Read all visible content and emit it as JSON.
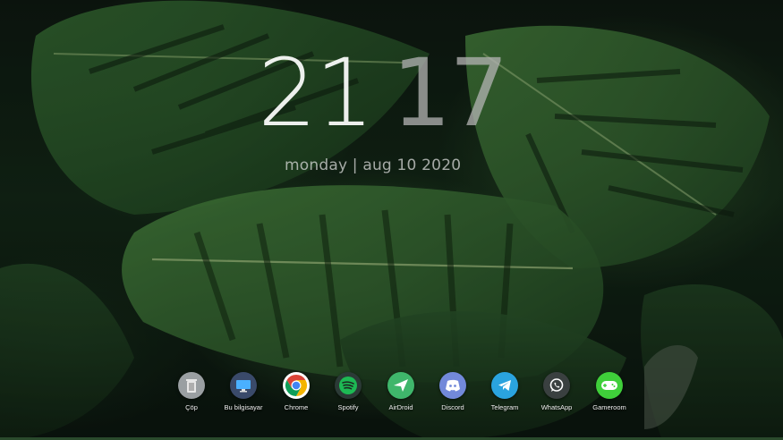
{
  "clock": {
    "hours": "21",
    "minutes": "17"
  },
  "date": "monday | aug 10 2020",
  "dock": {
    "items": [
      {
        "label": "Çöp",
        "icon": "trash-icon",
        "color": "#9a9fa2"
      },
      {
        "label": "Bu bilgisayar",
        "icon": "computer-icon",
        "color": "#3a4a6a"
      },
      {
        "label": "Chrome",
        "icon": "chrome-icon",
        "color": "#ffffff"
      },
      {
        "label": "Spotify",
        "icon": "spotify-icon",
        "color": "#2b3a36"
      },
      {
        "label": "AirDroid",
        "icon": "airdroid-icon",
        "color": "#3fb66b"
      },
      {
        "label": "Discord",
        "icon": "discord-icon",
        "color": "#7289da"
      },
      {
        "label": "Telegram",
        "icon": "telegram-icon",
        "color": "#2aa3df"
      },
      {
        "label": "WhatsApp",
        "icon": "whatsapp-icon",
        "color": "#3a4040"
      },
      {
        "label": "Gameroom",
        "icon": "gameroom-icon",
        "color": "#3fcf3a"
      }
    ]
  }
}
